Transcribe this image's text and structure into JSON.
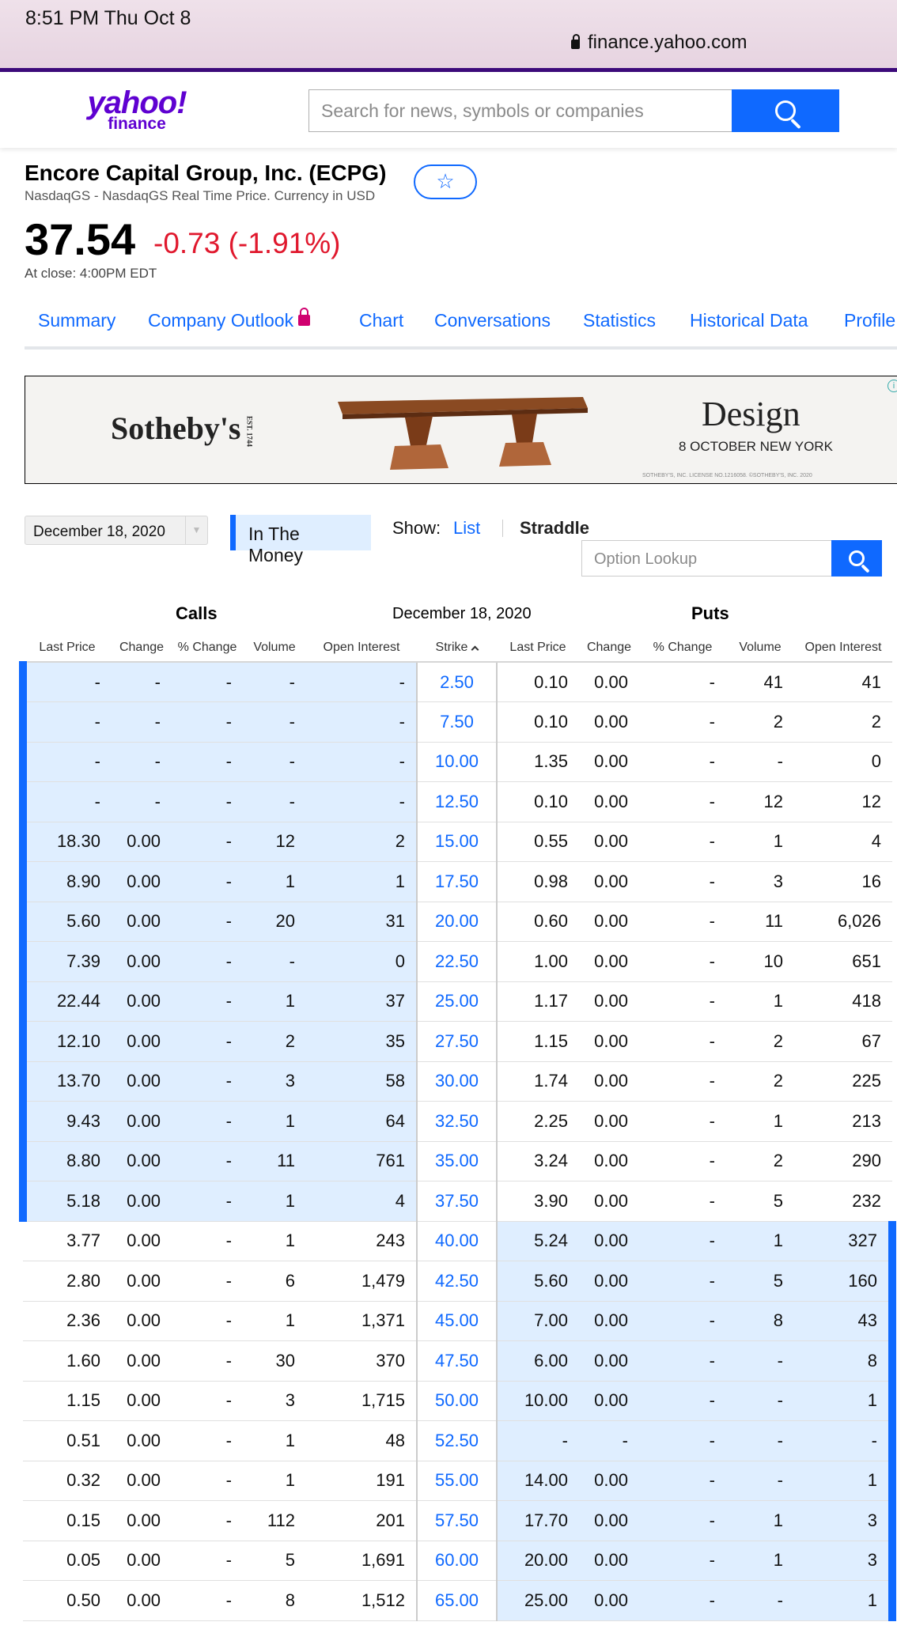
{
  "status": {
    "time": "8:51 PM   Thu Oct 8",
    "url": "finance.yahoo.com"
  },
  "header": {
    "logo_main": "yahoo!",
    "logo_sub": "finance",
    "search_placeholder": "Search for news, symbols or companies"
  },
  "quote": {
    "company": "Encore Capital Group, Inc. (ECPG)",
    "exchange": "NasdaqGS - NasdaqGS Real Time Price. Currency in USD",
    "price": "37.54",
    "change": "-0.73 (-1.91%)",
    "close_time": "At close: 4:00PM EDT",
    "star": "☆"
  },
  "tabs": [
    "Summary",
    "Company Outlook",
    "Chart",
    "Conversations",
    "Statistics",
    "Historical Data",
    "Profile"
  ],
  "ad": {
    "brand": "Sotheby's",
    "est": "EST. 1744",
    "title": "Design",
    "subtitle": "8 OCTOBER NEW YORK",
    "fine": "SOTHEBY'S, INC. LICENSE NO.1216058. ©SOTHEBY'S, INC. 2020"
  },
  "controls": {
    "expiration": "December 18, 2020",
    "in_the_money": "In The Money",
    "show_label": "Show:",
    "show_list": "List",
    "show_straddle": "Straddle",
    "lookup_placeholder": "Option Lookup"
  },
  "table": {
    "calls_label": "Calls",
    "date_label": "December 18, 2020",
    "puts_label": "Puts",
    "headers": [
      "Last Price",
      "Change",
      "% Change",
      "Volume",
      "Open Interest",
      "Strike",
      "Last Price",
      "Change",
      "% Change",
      "Volume",
      "Open Interest"
    ],
    "rows": [
      {
        "c": [
          "-",
          "-",
          "-",
          "-",
          "-"
        ],
        "strike": "2.50",
        "p": [
          "0.10",
          "0.00",
          "-",
          "41",
          "41"
        ],
        "call_itm": true,
        "put_itm": false
      },
      {
        "c": [
          "-",
          "-",
          "-",
          "-",
          "-"
        ],
        "strike": "7.50",
        "p": [
          "0.10",
          "0.00",
          "-",
          "2",
          "2"
        ],
        "call_itm": true,
        "put_itm": false
      },
      {
        "c": [
          "-",
          "-",
          "-",
          "-",
          "-"
        ],
        "strike": "10.00",
        "p": [
          "1.35",
          "0.00",
          "-",
          "-",
          "0"
        ],
        "call_itm": true,
        "put_itm": false
      },
      {
        "c": [
          "-",
          "-",
          "-",
          "-",
          "-"
        ],
        "strike": "12.50",
        "p": [
          "0.10",
          "0.00",
          "-",
          "12",
          "12"
        ],
        "call_itm": true,
        "put_itm": false
      },
      {
        "c": [
          "18.30",
          "0.00",
          "-",
          "12",
          "2"
        ],
        "strike": "15.00",
        "p": [
          "0.55",
          "0.00",
          "-",
          "1",
          "4"
        ],
        "call_itm": true,
        "put_itm": false
      },
      {
        "c": [
          "8.90",
          "0.00",
          "-",
          "1",
          "1"
        ],
        "strike": "17.50",
        "p": [
          "0.98",
          "0.00",
          "-",
          "3",
          "16"
        ],
        "call_itm": true,
        "put_itm": false
      },
      {
        "c": [
          "5.60",
          "0.00",
          "-",
          "20",
          "31"
        ],
        "strike": "20.00",
        "p": [
          "0.60",
          "0.00",
          "-",
          "11",
          "6,026"
        ],
        "call_itm": true,
        "put_itm": false
      },
      {
        "c": [
          "7.39",
          "0.00",
          "-",
          "-",
          "0"
        ],
        "strike": "22.50",
        "p": [
          "1.00",
          "0.00",
          "-",
          "10",
          "651"
        ],
        "call_itm": true,
        "put_itm": false
      },
      {
        "c": [
          "22.44",
          "0.00",
          "-",
          "1",
          "37"
        ],
        "strike": "25.00",
        "p": [
          "1.17",
          "0.00",
          "-",
          "1",
          "418"
        ],
        "call_itm": true,
        "put_itm": false
      },
      {
        "c": [
          "12.10",
          "0.00",
          "-",
          "2",
          "35"
        ],
        "strike": "27.50",
        "p": [
          "1.15",
          "0.00",
          "-",
          "2",
          "67"
        ],
        "call_itm": true,
        "put_itm": false
      },
      {
        "c": [
          "13.70",
          "0.00",
          "-",
          "3",
          "58"
        ],
        "strike": "30.00",
        "p": [
          "1.74",
          "0.00",
          "-",
          "2",
          "225"
        ],
        "call_itm": true,
        "put_itm": false
      },
      {
        "c": [
          "9.43",
          "0.00",
          "-",
          "1",
          "64"
        ],
        "strike": "32.50",
        "p": [
          "2.25",
          "0.00",
          "-",
          "1",
          "213"
        ],
        "call_itm": true,
        "put_itm": false
      },
      {
        "c": [
          "8.80",
          "0.00",
          "-",
          "11",
          "761"
        ],
        "strike": "35.00",
        "p": [
          "3.24",
          "0.00",
          "-",
          "2",
          "290"
        ],
        "call_itm": true,
        "put_itm": false
      },
      {
        "c": [
          "5.18",
          "0.00",
          "-",
          "1",
          "4"
        ],
        "strike": "37.50",
        "p": [
          "3.90",
          "0.00",
          "-",
          "5",
          "232"
        ],
        "call_itm": true,
        "put_itm": false
      },
      {
        "c": [
          "3.77",
          "0.00",
          "-",
          "1",
          "243"
        ],
        "strike": "40.00",
        "p": [
          "5.24",
          "0.00",
          "-",
          "1",
          "327"
        ],
        "call_itm": false,
        "put_itm": true
      },
      {
        "c": [
          "2.80",
          "0.00",
          "-",
          "6",
          "1,479"
        ],
        "strike": "42.50",
        "p": [
          "5.60",
          "0.00",
          "-",
          "5",
          "160"
        ],
        "call_itm": false,
        "put_itm": true
      },
      {
        "c": [
          "2.36",
          "0.00",
          "-",
          "1",
          "1,371"
        ],
        "strike": "45.00",
        "p": [
          "7.00",
          "0.00",
          "-",
          "8",
          "43"
        ],
        "call_itm": false,
        "put_itm": true
      },
      {
        "c": [
          "1.60",
          "0.00",
          "-",
          "30",
          "370"
        ],
        "strike": "47.50",
        "p": [
          "6.00",
          "0.00",
          "-",
          "-",
          "8"
        ],
        "call_itm": false,
        "put_itm": true
      },
      {
        "c": [
          "1.15",
          "0.00",
          "-",
          "3",
          "1,715"
        ],
        "strike": "50.00",
        "p": [
          "10.00",
          "0.00",
          "-",
          "-",
          "1"
        ],
        "call_itm": false,
        "put_itm": true
      },
      {
        "c": [
          "0.51",
          "0.00",
          "-",
          "1",
          "48"
        ],
        "strike": "52.50",
        "p": [
          "-",
          "-",
          "-",
          "-",
          "-"
        ],
        "call_itm": false,
        "put_itm": true
      },
      {
        "c": [
          "0.32",
          "0.00",
          "-",
          "1",
          "191"
        ],
        "strike": "55.00",
        "p": [
          "14.00",
          "0.00",
          "-",
          "-",
          "1"
        ],
        "call_itm": false,
        "put_itm": true
      },
      {
        "c": [
          "0.15",
          "0.00",
          "-",
          "112",
          "201"
        ],
        "strike": "57.50",
        "p": [
          "17.70",
          "0.00",
          "-",
          "1",
          "3"
        ],
        "call_itm": false,
        "put_itm": true
      },
      {
        "c": [
          "0.05",
          "0.00",
          "-",
          "5",
          "1,691"
        ],
        "strike": "60.00",
        "p": [
          "20.00",
          "0.00",
          "-",
          "1",
          "3"
        ],
        "call_itm": false,
        "put_itm": true
      },
      {
        "c": [
          "0.50",
          "0.00",
          "-",
          "8",
          "1,512"
        ],
        "strike": "65.00",
        "p": [
          "25.00",
          "0.00",
          "-",
          "-",
          "1"
        ],
        "call_itm": false,
        "put_itm": true
      }
    ]
  }
}
